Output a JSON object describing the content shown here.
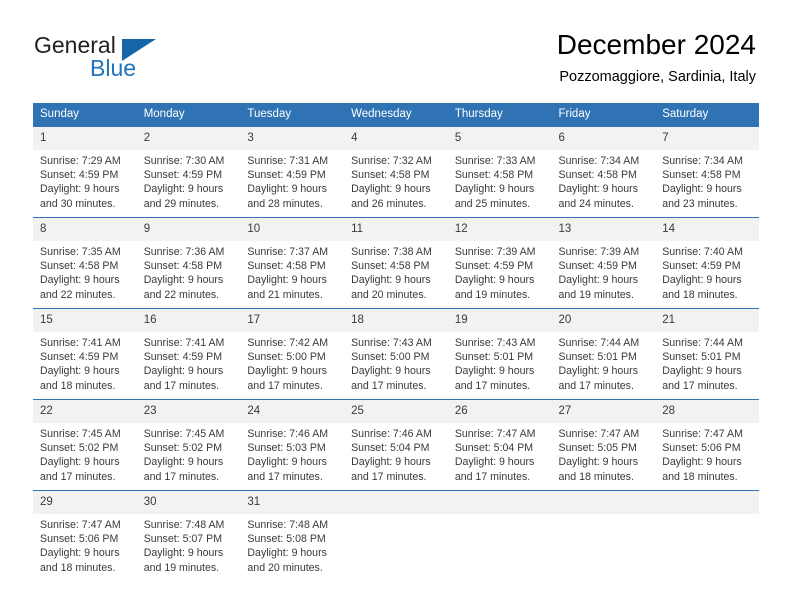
{
  "brand": {
    "name_top": "General",
    "name_bottom": "Blue",
    "accent_color": "#1565a8",
    "text_color": "#231f20"
  },
  "header": {
    "title": "December 2024",
    "subtitle": "Pozzomaggiore, Sardinia, Italy"
  },
  "theme": {
    "header_bar_color": "#2f73b4",
    "daynum_band_color": "#f2f2f2",
    "row_border_color": "#2f73b4",
    "text_color": "#3a3a3a"
  },
  "weekdays": [
    "Sunday",
    "Monday",
    "Tuesday",
    "Wednesday",
    "Thursday",
    "Friday",
    "Saturday"
  ],
  "weeks": [
    {
      "days": [
        {
          "date": "1",
          "sunrise": "Sunrise: 7:29 AM",
          "sunset": "Sunset: 4:59 PM",
          "daylight_line1": "Daylight: 9 hours",
          "daylight_line2": "and 30 minutes."
        },
        {
          "date": "2",
          "sunrise": "Sunrise: 7:30 AM",
          "sunset": "Sunset: 4:59 PM",
          "daylight_line1": "Daylight: 9 hours",
          "daylight_line2": "and 29 minutes."
        },
        {
          "date": "3",
          "sunrise": "Sunrise: 7:31 AM",
          "sunset": "Sunset: 4:59 PM",
          "daylight_line1": "Daylight: 9 hours",
          "daylight_line2": "and 28 minutes."
        },
        {
          "date": "4",
          "sunrise": "Sunrise: 7:32 AM",
          "sunset": "Sunset: 4:58 PM",
          "daylight_line1": "Daylight: 9 hours",
          "daylight_line2": "and 26 minutes."
        },
        {
          "date": "5",
          "sunrise": "Sunrise: 7:33 AM",
          "sunset": "Sunset: 4:58 PM",
          "daylight_line1": "Daylight: 9 hours",
          "daylight_line2": "and 25 minutes."
        },
        {
          "date": "6",
          "sunrise": "Sunrise: 7:34 AM",
          "sunset": "Sunset: 4:58 PM",
          "daylight_line1": "Daylight: 9 hours",
          "daylight_line2": "and 24 minutes."
        },
        {
          "date": "7",
          "sunrise": "Sunrise: 7:34 AM",
          "sunset": "Sunset: 4:58 PM",
          "daylight_line1": "Daylight: 9 hours",
          "daylight_line2": "and 23 minutes."
        }
      ]
    },
    {
      "days": [
        {
          "date": "8",
          "sunrise": "Sunrise: 7:35 AM",
          "sunset": "Sunset: 4:58 PM",
          "daylight_line1": "Daylight: 9 hours",
          "daylight_line2": "and 22 minutes."
        },
        {
          "date": "9",
          "sunrise": "Sunrise: 7:36 AM",
          "sunset": "Sunset: 4:58 PM",
          "daylight_line1": "Daylight: 9 hours",
          "daylight_line2": "and 22 minutes."
        },
        {
          "date": "10",
          "sunrise": "Sunrise: 7:37 AM",
          "sunset": "Sunset: 4:58 PM",
          "daylight_line1": "Daylight: 9 hours",
          "daylight_line2": "and 21 minutes."
        },
        {
          "date": "11",
          "sunrise": "Sunrise: 7:38 AM",
          "sunset": "Sunset: 4:58 PM",
          "daylight_line1": "Daylight: 9 hours",
          "daylight_line2": "and 20 minutes."
        },
        {
          "date": "12",
          "sunrise": "Sunrise: 7:39 AM",
          "sunset": "Sunset: 4:59 PM",
          "daylight_line1": "Daylight: 9 hours",
          "daylight_line2": "and 19 minutes."
        },
        {
          "date": "13",
          "sunrise": "Sunrise: 7:39 AM",
          "sunset": "Sunset: 4:59 PM",
          "daylight_line1": "Daylight: 9 hours",
          "daylight_line2": "and 19 minutes."
        },
        {
          "date": "14",
          "sunrise": "Sunrise: 7:40 AM",
          "sunset": "Sunset: 4:59 PM",
          "daylight_line1": "Daylight: 9 hours",
          "daylight_line2": "and 18 minutes."
        }
      ]
    },
    {
      "days": [
        {
          "date": "15",
          "sunrise": "Sunrise: 7:41 AM",
          "sunset": "Sunset: 4:59 PM",
          "daylight_line1": "Daylight: 9 hours",
          "daylight_line2": "and 18 minutes."
        },
        {
          "date": "16",
          "sunrise": "Sunrise: 7:41 AM",
          "sunset": "Sunset: 4:59 PM",
          "daylight_line1": "Daylight: 9 hours",
          "daylight_line2": "and 17 minutes."
        },
        {
          "date": "17",
          "sunrise": "Sunrise: 7:42 AM",
          "sunset": "Sunset: 5:00 PM",
          "daylight_line1": "Daylight: 9 hours",
          "daylight_line2": "and 17 minutes."
        },
        {
          "date": "18",
          "sunrise": "Sunrise: 7:43 AM",
          "sunset": "Sunset: 5:00 PM",
          "daylight_line1": "Daylight: 9 hours",
          "daylight_line2": "and 17 minutes."
        },
        {
          "date": "19",
          "sunrise": "Sunrise: 7:43 AM",
          "sunset": "Sunset: 5:01 PM",
          "daylight_line1": "Daylight: 9 hours",
          "daylight_line2": "and 17 minutes."
        },
        {
          "date": "20",
          "sunrise": "Sunrise: 7:44 AM",
          "sunset": "Sunset: 5:01 PM",
          "daylight_line1": "Daylight: 9 hours",
          "daylight_line2": "and 17 minutes."
        },
        {
          "date": "21",
          "sunrise": "Sunrise: 7:44 AM",
          "sunset": "Sunset: 5:01 PM",
          "daylight_line1": "Daylight: 9 hours",
          "daylight_line2": "and 17 minutes."
        }
      ]
    },
    {
      "days": [
        {
          "date": "22",
          "sunrise": "Sunrise: 7:45 AM",
          "sunset": "Sunset: 5:02 PM",
          "daylight_line1": "Daylight: 9 hours",
          "daylight_line2": "and 17 minutes."
        },
        {
          "date": "23",
          "sunrise": "Sunrise: 7:45 AM",
          "sunset": "Sunset: 5:02 PM",
          "daylight_line1": "Daylight: 9 hours",
          "daylight_line2": "and 17 minutes."
        },
        {
          "date": "24",
          "sunrise": "Sunrise: 7:46 AM",
          "sunset": "Sunset: 5:03 PM",
          "daylight_line1": "Daylight: 9 hours",
          "daylight_line2": "and 17 minutes."
        },
        {
          "date": "25",
          "sunrise": "Sunrise: 7:46 AM",
          "sunset": "Sunset: 5:04 PM",
          "daylight_line1": "Daylight: 9 hours",
          "daylight_line2": "and 17 minutes."
        },
        {
          "date": "26",
          "sunrise": "Sunrise: 7:47 AM",
          "sunset": "Sunset: 5:04 PM",
          "daylight_line1": "Daylight: 9 hours",
          "daylight_line2": "and 17 minutes."
        },
        {
          "date": "27",
          "sunrise": "Sunrise: 7:47 AM",
          "sunset": "Sunset: 5:05 PM",
          "daylight_line1": "Daylight: 9 hours",
          "daylight_line2": "and 18 minutes."
        },
        {
          "date": "28",
          "sunrise": "Sunrise: 7:47 AM",
          "sunset": "Sunset: 5:06 PM",
          "daylight_line1": "Daylight: 9 hours",
          "daylight_line2": "and 18 minutes."
        }
      ]
    },
    {
      "days": [
        {
          "date": "29",
          "sunrise": "Sunrise: 7:47 AM",
          "sunset": "Sunset: 5:06 PM",
          "daylight_line1": "Daylight: 9 hours",
          "daylight_line2": "and 18 minutes."
        },
        {
          "date": "30",
          "sunrise": "Sunrise: 7:48 AM",
          "sunset": "Sunset: 5:07 PM",
          "daylight_line1": "Daylight: 9 hours",
          "daylight_line2": "and 19 minutes."
        },
        {
          "date": "31",
          "sunrise": "Sunrise: 7:48 AM",
          "sunset": "Sunset: 5:08 PM",
          "daylight_line1": "Daylight: 9 hours",
          "daylight_line2": "and 20 minutes."
        },
        {
          "date": "",
          "sunrise": "",
          "sunset": "",
          "daylight_line1": "",
          "daylight_line2": ""
        },
        {
          "date": "",
          "sunrise": "",
          "sunset": "",
          "daylight_line1": "",
          "daylight_line2": ""
        },
        {
          "date": "",
          "sunrise": "",
          "sunset": "",
          "daylight_line1": "",
          "daylight_line2": ""
        },
        {
          "date": "",
          "sunrise": "",
          "sunset": "",
          "daylight_line1": "",
          "daylight_line2": ""
        }
      ]
    }
  ]
}
